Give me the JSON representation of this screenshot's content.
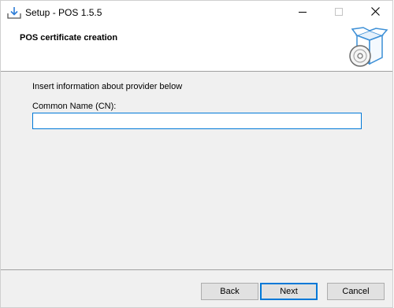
{
  "window": {
    "title": "Setup - POS 1.5.5"
  },
  "header": {
    "heading": "POS certificate creation"
  },
  "content": {
    "instruction": "Insert information about provider below",
    "cn_label": "Common Name (CN):",
    "cn_value": ""
  },
  "buttons": {
    "back": "Back",
    "next": "Next",
    "cancel": "Cancel"
  },
  "icons": {
    "app": "install-icon",
    "header": "software-box-icon",
    "minimize": "minimize-icon",
    "maximize": "maximize-icon",
    "close": "close-icon"
  },
  "colors": {
    "accent": "#0078d7",
    "box": "#3c8fd6"
  }
}
